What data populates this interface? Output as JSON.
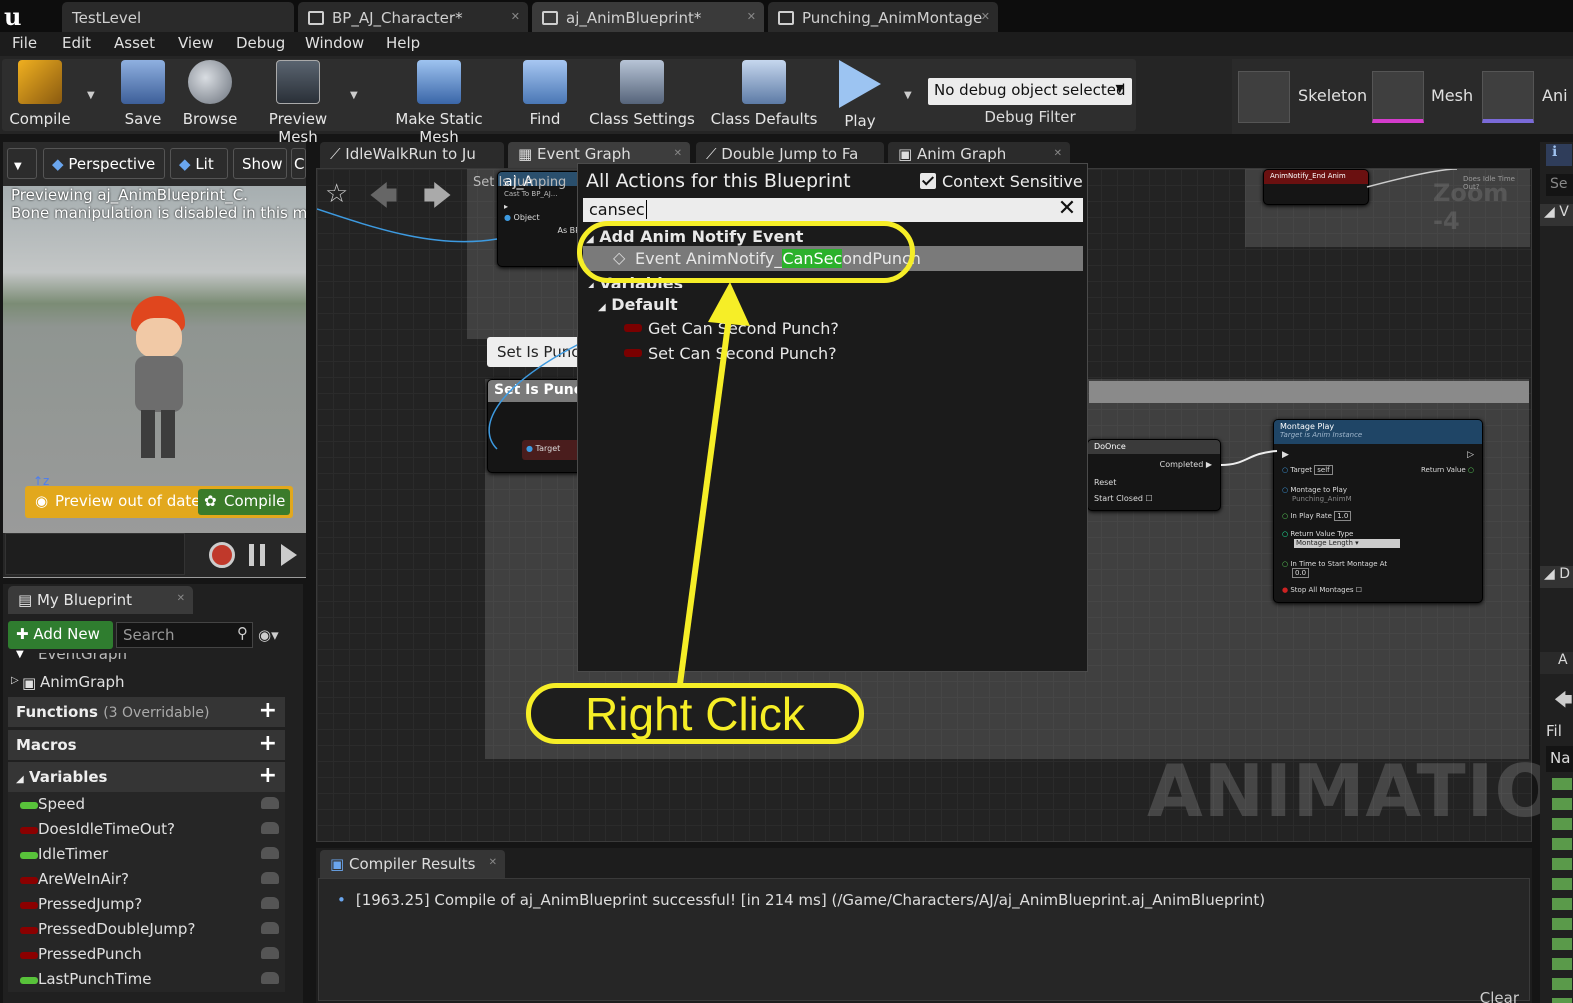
{
  "doc_tabs": [
    {
      "label": "TestLevel"
    },
    {
      "label": "BP_AJ_Character*"
    },
    {
      "label": "aj_AnimBlueprint*"
    },
    {
      "label": "Punching_AnimMontage"
    }
  ],
  "menu": [
    "File",
    "Edit",
    "Asset",
    "View",
    "Debug",
    "Window",
    "Help"
  ],
  "toolbar": {
    "compile": "Compile",
    "save": "Save",
    "browse": "Browse",
    "preview_mesh": "Preview Mesh",
    "make_static_mesh": "Make Static Mesh",
    "find": "Find",
    "class_settings": "Class Settings",
    "class_defaults": "Class Defaults",
    "play": "Play",
    "debug_select": "No debug object selected",
    "debug_filter": "Debug Filter"
  },
  "right_top": {
    "skeleton": "Skeleton",
    "mesh": "Mesh",
    "anim": "Ani"
  },
  "viewport": {
    "perspective": "Perspective",
    "lit": "Lit",
    "show": "Show",
    "message_line1": "Previewing aj_AnimBlueprint_C.",
    "message_line2": "Bone manipulation is disabled in this mode.",
    "preview_out_of_date": "Preview out of date",
    "compile": "Compile"
  },
  "my_blueprint": {
    "tab": "My Blueprint",
    "add_new": "Add New",
    "search_placeholder": "Search",
    "event_graph": "EventGraph",
    "anim_graph": "AnimGraph",
    "functions": "Functions",
    "functions_note": "(3 Overridable)",
    "macros": "Macros",
    "variables": "Variables",
    "vars": [
      {
        "name": "Speed",
        "color": "#58c23a"
      },
      {
        "name": "DoesIdleTimeOut?",
        "color": "#8a0000"
      },
      {
        "name": "IdleTimer",
        "color": "#58c23a"
      },
      {
        "name": "AreWeInAir?",
        "color": "#8a0000"
      },
      {
        "name": "PressedJump?",
        "color": "#8a0000"
      },
      {
        "name": "PressedDoubleJump?",
        "color": "#8a0000"
      },
      {
        "name": "PressedPunch",
        "color": "#8a0000"
      },
      {
        "name": "LastPunchTime",
        "color": "#58c23a"
      }
    ]
  },
  "graph_tabs": [
    {
      "label": "IdleWalkRun to Ju"
    },
    {
      "label": "Event Graph"
    },
    {
      "label": "Double Jump to Fa"
    },
    {
      "label": "Anim Graph"
    }
  ],
  "graph": {
    "set_is_punching_comment": "Set Is Punc",
    "set_is_punching_node": "Set Is Punch",
    "target_pin": "Target",
    "object_pin": "Object",
    "as_bp": "As BP",
    "set_is_jumping": "Set Is Jumping",
    "cast_title": "aj_A",
    "cast_sub": "Cast To BP_AJ...",
    "notify_end": "AnimNotify_End Anim",
    "zoom": "Zoom -4",
    "idle_timeout": "Does Idle Time Out?",
    "do_once": "DoOnce",
    "completed": "Completed",
    "reset": "Reset",
    "start_closed": "Start Closed",
    "montage_play": "Montage Play",
    "montage_sub": "Target is Anim Instance",
    "mp_target": "Target",
    "mp_self": "self",
    "mp_return": "Return Value",
    "mp_montage_to_play": "Montage to Play",
    "mp_montage_value": "Punching_AnimM",
    "mp_play_rate": "In Play Rate",
    "mp_play_rate_val": "1.0",
    "mp_return_type": "Return Value Type",
    "mp_return_type_val": "Montage Length",
    "mp_time_to_start": "In Time to Start Montage At",
    "mp_time_val": "0.0",
    "mp_stop_all": "Stop All Montages",
    "watermark": "ANIMATION"
  },
  "action_menu": {
    "title": "All Actions for this Blueprint",
    "context_sensitive": "Context Sensitive",
    "search_value": "cansec",
    "category_notify": "Add Anim Notify Event",
    "event_prefix": "Event AnimNotify_",
    "event_match": "CanSec",
    "event_suffix": "ondPunch",
    "category_variables": "Variables",
    "category_default": "Default",
    "get_item": "Get Can Second Punch?",
    "set_item": "Set Can Second Punch?"
  },
  "annotation": {
    "label": "Right Click",
    "color": "#f6ee27"
  },
  "compiler": {
    "tab": "Compiler Results",
    "message": "[1963.25] Compile of aj_AnimBlueprint successful! [in 214 ms] (/Game/Characters/AJ/aj_AnimBlueprint.aj_AnimBlueprint)",
    "clear": "Clear"
  },
  "right_strip": {
    "search": "Se",
    "filter": "Fil",
    "name": "Na"
  }
}
